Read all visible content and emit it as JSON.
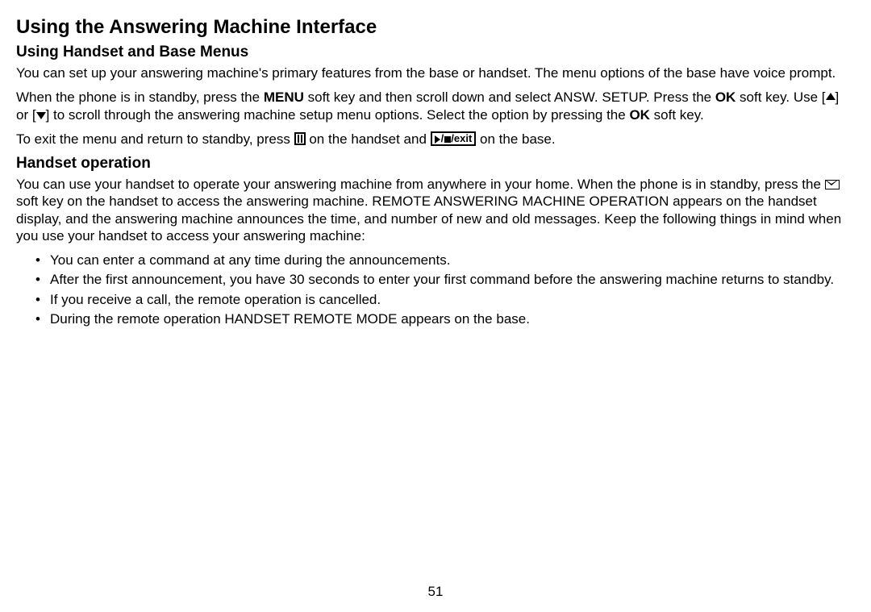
{
  "title": "Using the Answering Machine Interface",
  "section1": {
    "heading": "Using Handset and Base Menus",
    "para1": "You can set up your answering machine's primary features from the base or handset. The menu options of the base have voice prompt.",
    "para2_a": "When the phone is in standby, press the ",
    "para2_menu": "MENU",
    "para2_b": " soft key and then scroll down and select ANSW. SETUP. Press the ",
    "para2_ok1": "OK",
    "para2_c": " soft key. Use [",
    "para2_d": "] or [",
    "para2_e": "] to scroll through the answering machine setup menu options. Select the option by pressing the ",
    "para2_ok2": "OK",
    "para2_f": " soft key.",
    "para3_a": "To exit the menu and return to standby, press ",
    "para3_b": " on the handset and ",
    "para3_exit": "/exit",
    "para3_c": " on the base."
  },
  "section2": {
    "heading": "Handset operation",
    "para1_a": "You can use your handset to operate your answering machine from anywhere in your home. When the phone is in standby, press the ",
    "para1_b": " soft key on the handset to access the answering machine. REMOTE ANSWERING MACHINE OPERATION appears on the handset display, and the answering machine announces the time, and number of new and old messages. Keep the following things in mind when you use your handset to access your answering machine:",
    "bullets": {
      "b1": "You can enter a command at any time during the announcements.",
      "b2": "After the first announcement, you have 30 seconds to enter your first command before the answering machine returns to standby.",
      "b3": "If you receive a call, the remote operation is cancelled.",
      "b4": "During the remote operation HANDSET REMOTE MODE appears on the base."
    }
  },
  "pageNumber": "51"
}
